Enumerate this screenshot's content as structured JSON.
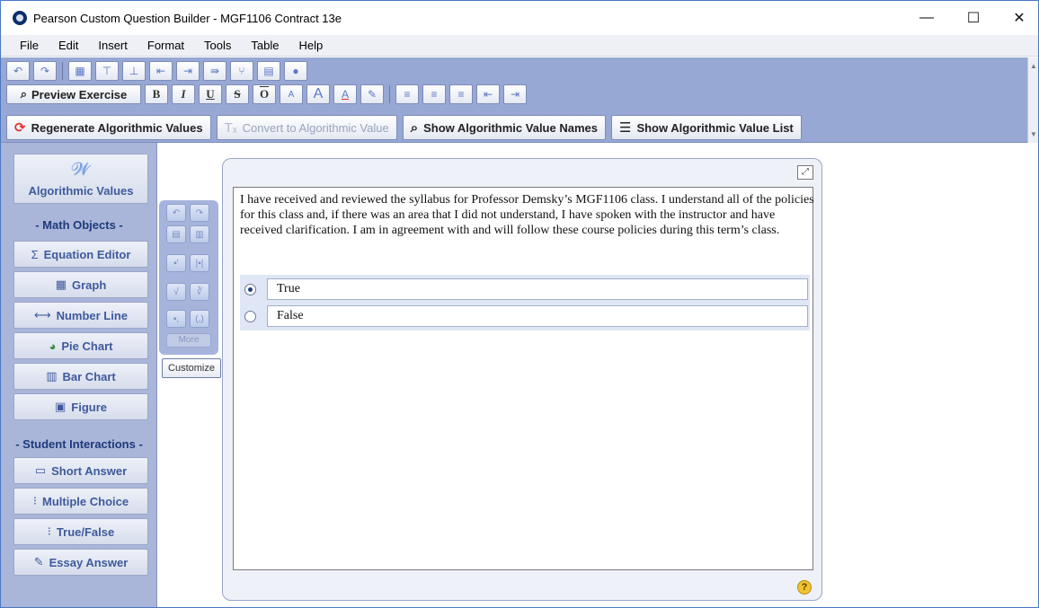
{
  "window": {
    "title": "Pearson Custom Question Builder - MGF1106 Contract 13e",
    "minimize": "—",
    "maximize": "☐",
    "close": "✕"
  },
  "menu": [
    "File",
    "Edit",
    "Insert",
    "Format",
    "Tools",
    "Table",
    "Help"
  ],
  "toolbar": {
    "preview_label": "Preview Exercise",
    "bold": "B",
    "italic": "I",
    "underline": "U",
    "strike": "S",
    "overline": "O",
    "regenerate": "Regenerate Algorithmic Values",
    "convert": "Convert to Algorithmic Value",
    "show_names": "Show Algorithmic Value Names",
    "show_list": "Show Algorithmic Value List"
  },
  "left_panel": {
    "algorithmic": "Algorithmic Values",
    "math_heading": "- Math Objects -",
    "equation_editor": "Equation Editor",
    "graph": "Graph",
    "number_line": "Number Line",
    "pie_chart": "Pie Chart",
    "bar_chart": "Bar Chart",
    "figure": "Figure",
    "student_heading": "- Student Interactions -",
    "short_answer": "Short Answer",
    "multiple_choice": "Multiple Choice",
    "true_false": "True/False",
    "essay_answer": "Essay Answer"
  },
  "mini_tools": {
    "more": "More",
    "customize": "Customize"
  },
  "editor": {
    "question": "I have received and reviewed the syllabus for Professor Demsky’s MGF1106 class.  I understand all of the policies for this class and, if there was an area that I did not understand, I have spoken with the instructor and have received clarification.  I am in agreement with and will follow these course policies during this term’s class.",
    "answers": [
      {
        "label": "True",
        "selected": true
      },
      {
        "label": "False",
        "selected": false
      }
    ],
    "help": "?"
  }
}
